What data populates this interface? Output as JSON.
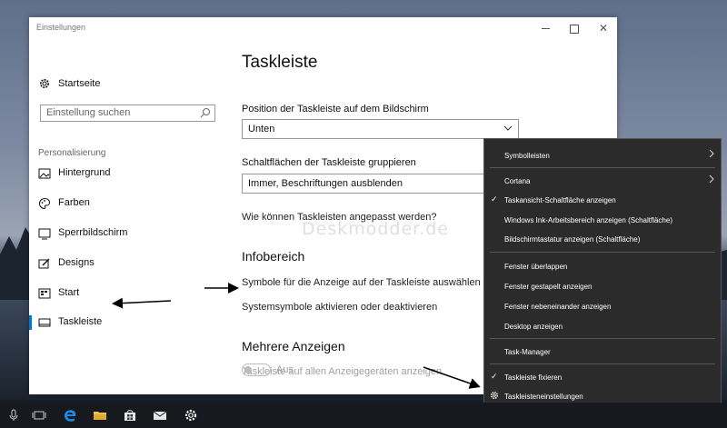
{
  "window": {
    "title": "Einstellungen"
  },
  "nav": {
    "home_label": "Startseite",
    "search_placeholder": "Einstellung suchen",
    "section_header": "Personalisierung",
    "items": [
      {
        "label": "Hintergrund",
        "icon": "picture-icon"
      },
      {
        "label": "Farben",
        "icon": "palette-icon"
      },
      {
        "label": "Sperrbildschirm",
        "icon": "lock-screen-icon"
      },
      {
        "label": "Designs",
        "icon": "brush-icon"
      },
      {
        "label": "Start",
        "icon": "start-icon"
      },
      {
        "label": "Taskleiste",
        "icon": "taskbar-icon",
        "active": true
      }
    ]
  },
  "content": {
    "title": "Taskleiste",
    "position_label": "Position der Taskleiste auf dem Bildschirm",
    "position_value": "Unten",
    "group_label": "Schaltflächen der Taskleiste gruppieren",
    "group_value": "Immer, Beschriftungen ausblenden",
    "customize_link": "Wie können Taskleisten angepasst werden?",
    "infobereich_header": "Infobereich",
    "symbols_link": "Symbole für die Anzeige auf der Taskleiste auswählen",
    "system_symbols_link": "Systemsymbole aktivieren oder deaktivieren",
    "multi_header": "Mehrere Anzeigen",
    "multi_label": "Taskleiste auf allen Anzeigegeräten anzeigen",
    "multi_toggle": "Aus"
  },
  "watermark": "Deskmodder.de",
  "context_menu": {
    "items": [
      {
        "label": "Symbolleisten",
        "submenu": true
      },
      {
        "label": "Cortana",
        "submenu": true
      },
      {
        "label": "Taskansicht-Schaltfläche anzeigen",
        "checked": true
      },
      {
        "label": "Windows Ink-Arbeitsbereich anzeigen (Schaltfläche)"
      },
      {
        "label": "Bildschirmtastatur anzeigen (Schaltfläche)"
      },
      {
        "label": "Fenster überlappen"
      },
      {
        "label": "Fenster gestapelt anzeigen"
      },
      {
        "label": "Fenster nebeneinander anzeigen"
      },
      {
        "label": "Desktop anzeigen"
      },
      {
        "label": "Task-Manager"
      },
      {
        "label": "Taskleiste fixieren",
        "checked": true
      },
      {
        "label": "Taskleisteneinstellungen",
        "icon": "gear-icon"
      }
    ]
  },
  "colors": {
    "accent": "#0078d7",
    "menu_bg": "#2b2b2b",
    "taskbar_bg": "#16191d"
  }
}
